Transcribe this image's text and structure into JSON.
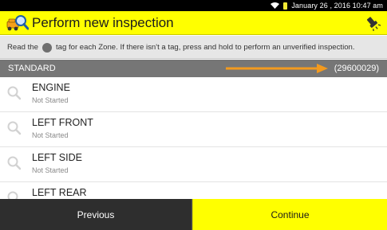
{
  "status_bar": {
    "datetime": "January 26 , 2016 10:47 am",
    "icons": [
      "wifi-icon",
      "battery-icon"
    ]
  },
  "header": {
    "title": "Perform new inspection",
    "icons": [
      "inspection-app-icon",
      "flashlight-icon"
    ]
  },
  "instructions": {
    "part1": "Read the",
    "part2": "tag for each Zone. If there isn't a tag, press and hold to perform an unverified inspection.",
    "icon": "zone-tag-icon"
  },
  "section": {
    "label": "STANDARD",
    "code": "(29600029)",
    "annotation": "orange-arrow-icon"
  },
  "zones": [
    {
      "name": "ENGINE",
      "status": "Not Started"
    },
    {
      "name": "LEFT FRONT",
      "status": "Not Started"
    },
    {
      "name": "LEFT SIDE",
      "status": "Not Started"
    },
    {
      "name": "LEFT REAR",
      "status": ""
    }
  ],
  "buttons": {
    "previous": "Previous",
    "continue": "Continue"
  },
  "colors": {
    "header_bg": "#ffff00",
    "status_bar_bg": "#000000",
    "section_bg": "#767676",
    "accent_arrow": "#f39a1e",
    "previous_bg": "#2e2e2e",
    "continue_bg": "#ffff00"
  }
}
